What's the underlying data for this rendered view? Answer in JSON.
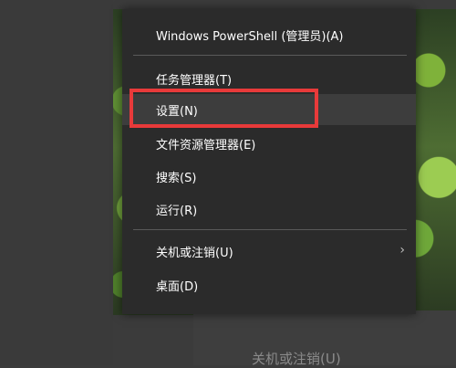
{
  "menu": {
    "items": [
      {
        "label": "Windows PowerShell (管理员)(A)"
      },
      {
        "label": "任务管理器(T)"
      },
      {
        "label": "设置(N)"
      },
      {
        "label": "文件资源管理器(E)"
      },
      {
        "label": "搜索(S)"
      },
      {
        "label": "运行(R)"
      },
      {
        "label": "关机或注销(U)",
        "submenu_arrow": "›"
      },
      {
        "label": "桌面(D)"
      }
    ]
  },
  "background": {
    "partial_menu_label": "关机或注销(U)"
  },
  "annotation": {
    "highlight_color": "#e83a3a",
    "highlighted_item": "设置(N)"
  }
}
